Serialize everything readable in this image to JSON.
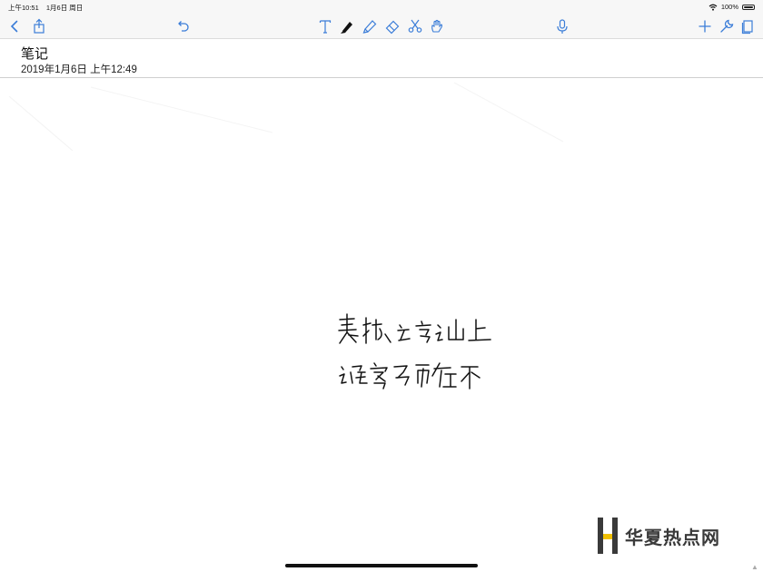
{
  "status_bar": {
    "time": "上午10:51",
    "date": "1月6日 周日",
    "battery_percent": "100%"
  },
  "toolbar": {
    "left": [
      "back-icon",
      "share-icon",
      "undo-icon"
    ],
    "tools": [
      "text-tool-icon",
      "pen-tool-icon",
      "highlighter-tool-icon",
      "eraser-tool-icon",
      "scissors-tool-icon",
      "hand-tool-icon"
    ],
    "center": [
      "microphone-icon"
    ],
    "right": [
      "add-icon",
      "wrench-icon",
      "pages-icon"
    ],
    "active_tool": "pen-tool-icon",
    "accent_color": "#3b7dd8"
  },
  "note": {
    "title": "笔记",
    "datetime": "2019年1月6日 上午12:49"
  },
  "handwriting": {
    "ink_color": "#111111",
    "lines": [
      "表被立方云山上",
      "云居客马来在下"
    ]
  },
  "watermark": {
    "text": "华夏热点网"
  }
}
